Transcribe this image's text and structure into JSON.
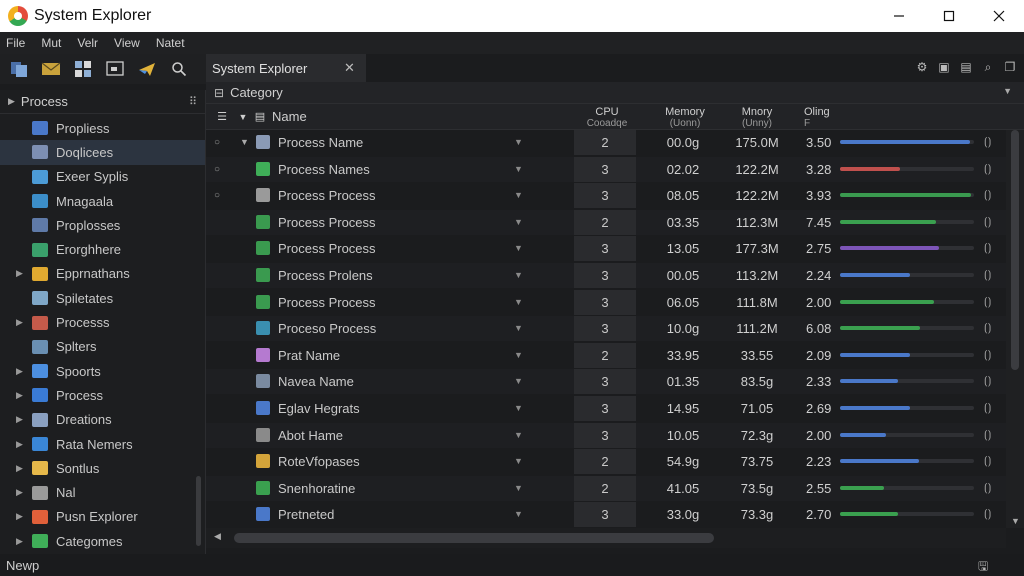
{
  "window": {
    "title": "System Explorer"
  },
  "menu": [
    "File",
    "Mut",
    "Velr",
    "View",
    "Natet"
  ],
  "toolbar": {
    "icons": [
      "copy-icon",
      "mail-icon",
      "grid-icon",
      "screen-icon",
      "plane-icon",
      "search-icon"
    ]
  },
  "sidebar": {
    "header": "Process",
    "items": [
      {
        "label": "Propliess",
        "icon_color": "#4a78c9",
        "has_caret": false,
        "active": false
      },
      {
        "label": "Doqlicees",
        "icon_color": "#7d8fb3",
        "has_caret": false,
        "active": true
      },
      {
        "label": "Exeer Syplis",
        "icon_color": "#4c9bd6",
        "has_caret": false,
        "active": false
      },
      {
        "label": "Mnagaala",
        "icon_color": "#3c8ec8",
        "has_caret": false,
        "active": false
      },
      {
        "label": "Proplosses",
        "icon_color": "#5f7aa8",
        "has_caret": false,
        "active": false
      },
      {
        "label": "Erorghhere",
        "icon_color": "#3aa06b",
        "has_caret": false,
        "active": false
      },
      {
        "label": "Epprnathans",
        "icon_color": "#e0a930",
        "has_caret": true,
        "active": false
      },
      {
        "label": "Spiletates",
        "icon_color": "#7fa7c7",
        "has_caret": false,
        "active": false
      },
      {
        "label": "Processs",
        "icon_color": "#c45a4a",
        "has_caret": true,
        "active": false
      },
      {
        "label": "Splters",
        "icon_color": "#6a8fb2",
        "has_caret": false,
        "active": false
      },
      {
        "label": "Spoorts",
        "icon_color": "#4c8fe0",
        "has_caret": true,
        "active": false
      },
      {
        "label": "Process",
        "icon_color": "#3a7bd5",
        "has_caret": true,
        "active": false
      },
      {
        "label": "Dreations",
        "icon_color": "#8aa0c0",
        "has_caret": true,
        "active": false
      },
      {
        "label": "Rata Nemers",
        "icon_color": "#3a86d6",
        "has_caret": true,
        "active": false
      },
      {
        "label": "Sontlus",
        "icon_color": "#e6b84a",
        "has_caret": true,
        "active": false
      },
      {
        "label": "Nal",
        "icon_color": "#9a9a9a",
        "has_caret": true,
        "active": false
      },
      {
        "label": "Pusn Explorer",
        "icon_color": "#e0603a",
        "has_caret": true,
        "active": false
      },
      {
        "label": "Categomes",
        "icon_color": "#3fae58",
        "has_caret": true,
        "active": false
      }
    ]
  },
  "tab": {
    "label": "System Explorer"
  },
  "category_bar": {
    "label": "Category"
  },
  "columns": {
    "name": "Name",
    "cpu": "CPU",
    "cpu_sub": "Cooadqe",
    "memory": "Memory",
    "memory_sub": "(Uonn)",
    "memory2": "Mnory",
    "memory2_sub": "(Unny)",
    "disk": "Oling",
    "disk_sub": "F"
  },
  "rows": [
    {
      "name": "Process Name",
      "cpu": "2",
      "mem": "00.0g",
      "mem2": "175.0M",
      "disk": "3.50",
      "bar": 0.97,
      "bar_color": "#4a78c9",
      "icon_color": "#8a9ab5",
      "indicator": "○",
      "expander": "▼"
    },
    {
      "name": "Process Names",
      "cpu": "3",
      "mem": "02.02",
      "mem2": "122.2M",
      "disk": "3.28",
      "bar": 0.45,
      "bar_color": "#c0504d",
      "icon_color": "#3fae58",
      "indicator": "○",
      "expander": ""
    },
    {
      "name": "Process Process",
      "cpu": "3",
      "mem": "08.05",
      "mem2": "122.2M",
      "disk": "3.93",
      "bar": 0.98,
      "bar_color": "#3a9a4f",
      "icon_color": "#9a9a9a",
      "indicator": "○",
      "expander": ""
    },
    {
      "name": "Process Process",
      "cpu": "2",
      "mem": "03.35",
      "mem2": "112.3M",
      "disk": "7.45",
      "bar": 0.72,
      "bar_color": "#3aa04f",
      "icon_color": "#3a9a4f",
      "indicator": "",
      "expander": ""
    },
    {
      "name": "Process Process",
      "cpu": "3",
      "mem": "13.05",
      "mem2": "177.3M",
      "disk": "2.75",
      "bar": 0.74,
      "bar_color": "#7d55b8",
      "icon_color": "#3a9a4f",
      "indicator": "",
      "expander": ""
    },
    {
      "name": "Process Prolens",
      "cpu": "3",
      "mem": "00.05",
      "mem2": "113.2M",
      "disk": "2.24",
      "bar": 0.52,
      "bar_color": "#4a78c9",
      "icon_color": "#3a9a4f",
      "indicator": "",
      "expander": ""
    },
    {
      "name": "Process Process",
      "cpu": "3",
      "mem": "06.05",
      "mem2": "111.8M",
      "disk": "2.00",
      "bar": 0.7,
      "bar_color": "#3aa04f",
      "icon_color": "#3a9a4f",
      "indicator": "",
      "expander": ""
    },
    {
      "name": "Proceso Process",
      "cpu": "3",
      "mem": "10.0g",
      "mem2": "111.2M",
      "disk": "6.08",
      "bar": 0.6,
      "bar_color": "#3aa04f",
      "icon_color": "#3a8fb0",
      "indicator": "",
      "expander": ""
    },
    {
      "name": "Prat Name",
      "cpu": "2",
      "mem": "33.95",
      "mem2": "33.55",
      "disk": "2.09",
      "bar": 0.52,
      "bar_color": "#4a78c9",
      "icon_color": "#b57ad0",
      "indicator": "",
      "expander": ""
    },
    {
      "name": "Navea Name",
      "cpu": "3",
      "mem": "01.35",
      "mem2": "83.5g",
      "disk": "2.33",
      "bar": 0.43,
      "bar_color": "#4a78c9",
      "icon_color": "#7a8aa0",
      "indicator": "",
      "expander": ""
    },
    {
      "name": "Eglav Hegrats",
      "cpu": "3",
      "mem": "14.95",
      "mem2": "71.05",
      "disk": "2.69",
      "bar": 0.52,
      "bar_color": "#4a78c9",
      "icon_color": "#4a78c9",
      "indicator": "",
      "expander": ""
    },
    {
      "name": "Abot Hame",
      "cpu": "3",
      "mem": "10.05",
      "mem2": "72.3g",
      "disk": "2.00",
      "bar": 0.34,
      "bar_color": "#4a78c9",
      "icon_color": "#8a8a8a",
      "indicator": "",
      "expander": ""
    },
    {
      "name": "RoteVfopases",
      "cpu": "2",
      "mem": "54.9g",
      "mem2": "73.75",
      "disk": "2.23",
      "bar": 0.59,
      "bar_color": "#4a78c9",
      "icon_color": "#d4a43a",
      "indicator": "",
      "expander": ""
    },
    {
      "name": "Snenhoratine",
      "cpu": "2",
      "mem": "41.05",
      "mem2": "73.5g",
      "disk": "2.55",
      "bar": 0.33,
      "bar_color": "#3aa04f",
      "icon_color": "#3aa04f",
      "indicator": "",
      "expander": ""
    },
    {
      "name": "Pretneted",
      "cpu": "3",
      "mem": "33.0g",
      "mem2": "73.3g",
      "disk": "2.70",
      "bar": 0.43,
      "bar_color": "#3aa04f",
      "icon_color": "#4a78c9",
      "indicator": "",
      "expander": ""
    }
  ],
  "status": {
    "text": "Newp"
  }
}
